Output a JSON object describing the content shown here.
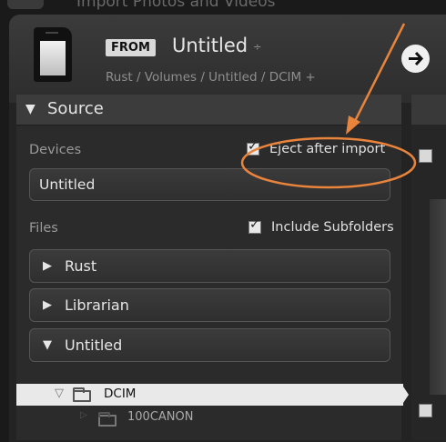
{
  "background_title": "Import Photos and Videos",
  "header": {
    "from_label": "FROM",
    "source_name": "Untitled",
    "source_toggle": "÷",
    "path": "Rust / Volumes / Untitled / DCIM +"
  },
  "source_panel": {
    "title": "Source",
    "devices_label": "Devices",
    "eject_label": "Eject after import",
    "eject_checked": true,
    "device_name": "Untitled",
    "files_label": "Files",
    "subfolders_label": "Include Subfolders",
    "subfolders_checked": true,
    "check_mark": "✓",
    "folders": [
      {
        "label": "Rust",
        "expanded": false,
        "arrow": "▶"
      },
      {
        "label": "Librarian",
        "expanded": false,
        "arrow": "▶"
      },
      {
        "label": "Untitled",
        "expanded": true,
        "arrow": "▼"
      }
    ],
    "subfolders": [
      {
        "label": "DCIM",
        "selected": true,
        "arrow": "▽"
      },
      {
        "label": "100CANON",
        "selected": false,
        "arrow": "▷"
      }
    ]
  },
  "annotation_color": "#e8843c"
}
